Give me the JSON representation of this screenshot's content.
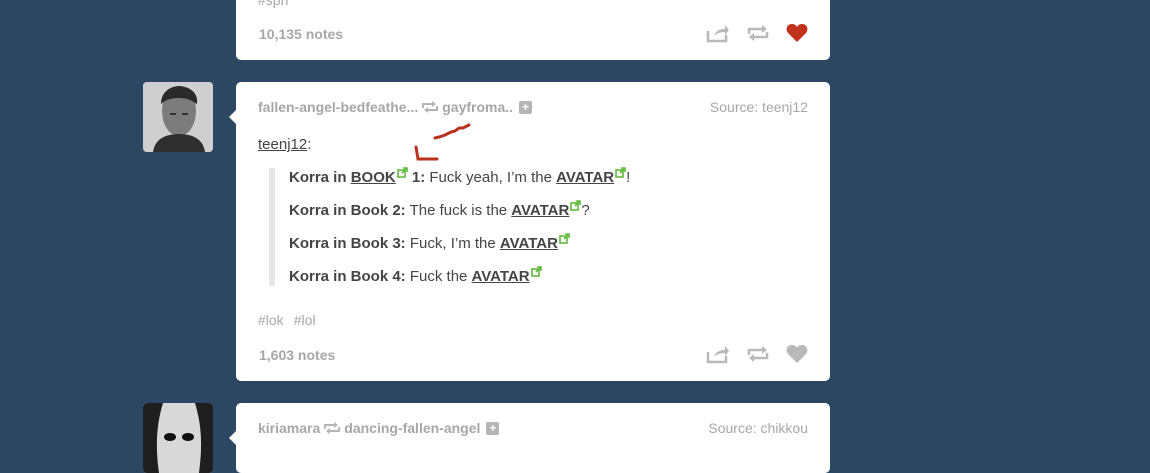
{
  "top_post": {
    "partial_tag": "#spn",
    "notes": "10,135 notes",
    "liked_color": "#c0321a"
  },
  "post": {
    "reblogger": "fallen-angel-bedfeathe...",
    "reblogged_from": "gayfroma..",
    "source": "Source: teenj12",
    "attribution_user": "teenj12",
    "attribution_suffix": ":",
    "quotes": [
      {
        "bold": "Korra in ",
        "link": "BOOK",
        "rest_bold": " 1:",
        "text": " Fuck yeah, I’m the ",
        "avatar": "AVATAR",
        "end": "!"
      },
      {
        "bold": "Korra in Book 2:",
        "text": " The fuck is the ",
        "avatar": "AVATAR",
        "end": "?"
      },
      {
        "bold": "Korra in Book 3:",
        "text": " Fuck, I’m the ",
        "avatar": "AVATAR",
        "end": ""
      },
      {
        "bold": "Korra in Book 4:",
        "text": " Fuck the ",
        "avatar": "AVATAR",
        "end": ""
      }
    ],
    "tags": [
      "#lok",
      "#lol"
    ],
    "notes": "1,603 notes"
  },
  "bottom_post": {
    "reblogger": "kiriamara",
    "reblogged_from": "dancing-fallen-angel",
    "source": "Source: chikkou"
  },
  "icons": {
    "share": "share-icon",
    "reblog": "reblog-icon",
    "like": "heart-icon",
    "external": "external-link-icon"
  },
  "colors": {
    "background": "#2c4762",
    "link_ext": "#5fba3b"
  }
}
